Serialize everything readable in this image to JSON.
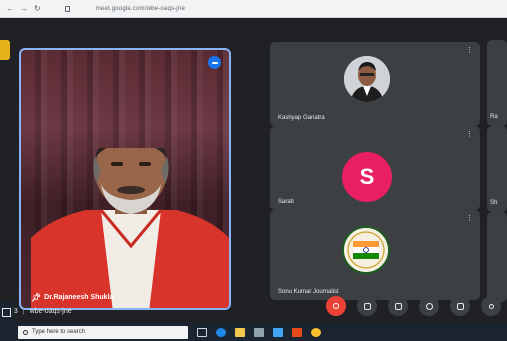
{
  "browser": {
    "address": "meet.google.com/wbe-oaqs-jne"
  },
  "main_speaker": {
    "name": "Dr.Rajaneesh Shukla"
  },
  "participants": [
    {
      "name": "Kashyap Ganatra",
      "avatar": "photo"
    },
    {
      "name": "Sarati",
      "avatar_letter": "S",
      "avatar_color": "#e91e63"
    },
    {
      "name": "Sonu Kumar Journalist",
      "avatar": "logo"
    }
  ],
  "edge_tiles": [
    "Ra",
    "Sh",
    ""
  ],
  "more_options_glyph": "⋮",
  "meeting": {
    "time": "43",
    "code": "wbe-oaqs-jne"
  },
  "taskbar": {
    "search_placeholder": "Type here to search"
  },
  "colors": {
    "active_speaker_border": "#8ab4f8",
    "mic_off": "#ea4335",
    "meet_background": "#202124",
    "tile_background": "#3c4043"
  },
  "icons": [
    "pin-icon",
    "mic-icon",
    "camera-icon",
    "captions-icon",
    "reaction-icon",
    "present-icon",
    "more-options-icon",
    "search-icon",
    "windows-start-icon"
  ]
}
